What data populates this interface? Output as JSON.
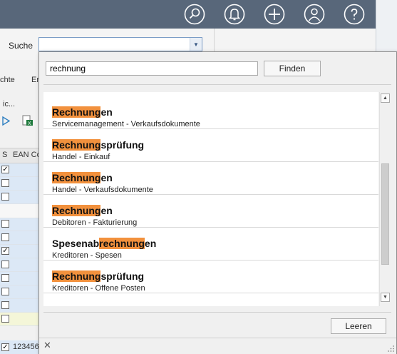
{
  "topbar": {
    "color": "#58677a",
    "icons": [
      {
        "name": "search-icon"
      },
      {
        "name": "bell-icon"
      },
      {
        "name": "plus-icon"
      },
      {
        "name": "user-icon"
      },
      {
        "name": "help-icon"
      }
    ]
  },
  "search_label": "Suche",
  "background": {
    "ribbon_texts": [
      "chte",
      "Er"
    ],
    "ribbon_text3": "ic...",
    "grid_header_s": "S",
    "grid_header_ean": "EAN Co",
    "bottom_value": "123456",
    "row_checks": [
      true,
      false,
      false,
      false,
      false,
      true,
      false,
      false,
      false,
      false,
      false
    ]
  },
  "popup": {
    "query": "rechnung",
    "find_button": "Finden",
    "clear_button": "Leeren",
    "highlight_color": "#f2913d",
    "results": [
      {
        "pre": "",
        "hl": "Rechnung",
        "post": "en",
        "sub": "Servicemanagement - Verkaufsdokumente"
      },
      {
        "pre": "",
        "hl": "Rechnung",
        "post": "sprüfung",
        "sub": "Handel - Einkauf"
      },
      {
        "pre": "",
        "hl": "Rechnung",
        "post": "en",
        "sub": "Handel - Verkaufsdokumente"
      },
      {
        "pre": "",
        "hl": "Rechnung",
        "post": "en",
        "sub": "Debitoren - Fakturierung"
      },
      {
        "pre": "Spesenab",
        "hl": "rechnung",
        "post": "en",
        "sub": "Kreditoren - Spesen"
      },
      {
        "pre": "",
        "hl": "Rechnung",
        "post": "sprüfung",
        "sub": "Kreditoren - Offene Posten"
      }
    ]
  }
}
